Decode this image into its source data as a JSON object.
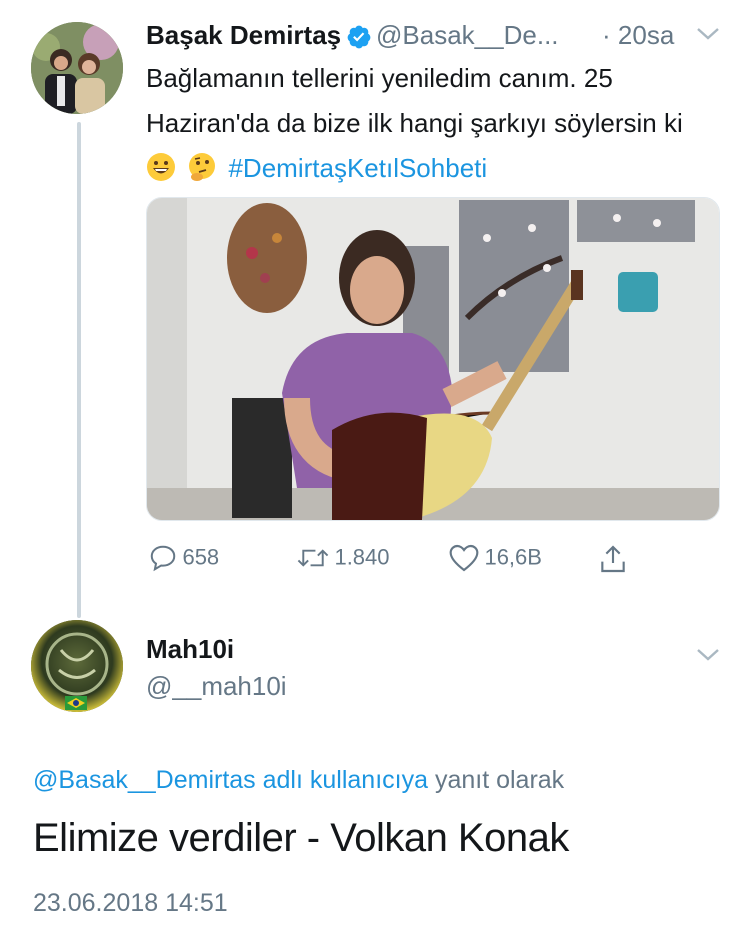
{
  "tweet": {
    "author_name": "Başak Demirtaş",
    "author_handle": "@Basak__De...",
    "separator": "·",
    "time_ago": "20sa",
    "text_part": "Bağlamanın tellerini yeniledim canım. 25 Haziran'da da bize ilk hangi şarkıyı söylersin ki ",
    "hashtag": "#DemirtaşKetılSohbeti",
    "emoji_1": "grinning-face-emoji",
    "emoji_2": "thinking-face-emoji",
    "stats": {
      "replies": "658",
      "retweets": "1.840",
      "likes": "16,6B"
    }
  },
  "reply": {
    "author_name": "Mah10i",
    "author_handle": "@__mah10i",
    "reply_to_link": "@Basak__Demirtas adlı kullanıcıya",
    "reply_to_suffix": " yanıt olarak",
    "text": "Elimize verdiler - Volkan Konak",
    "timestamp": "23.06.2018 14:51"
  },
  "colors": {
    "accent": "#1b95e0",
    "muted": "#657786",
    "verified": "#1da1f2",
    "thread_line": "#ccd6dd"
  }
}
